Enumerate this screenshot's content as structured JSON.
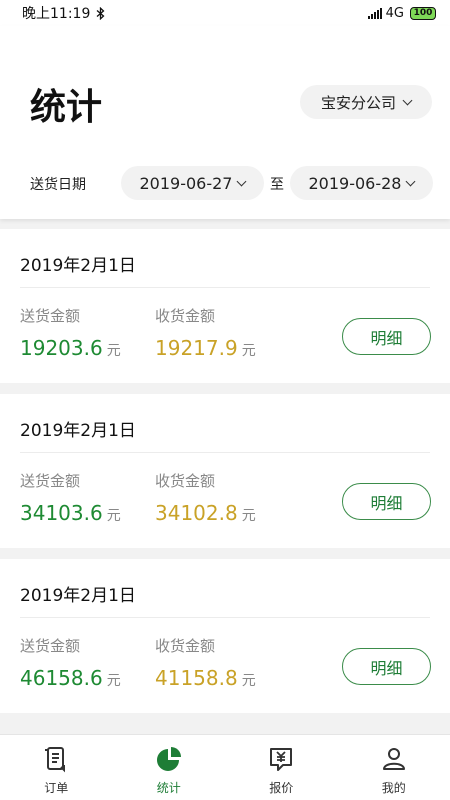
{
  "status_bar": {
    "time": "晚上11:19",
    "network": "4G",
    "battery": "100"
  },
  "header": {
    "title": "统计",
    "company": "宝安分公司"
  },
  "filter": {
    "date_label": "送货日期",
    "date_from": "2019-06-27",
    "separator": "至",
    "date_to": "2019-06-28"
  },
  "cards": [
    {
      "date": "2019年2月1日",
      "send_label": "送货金额",
      "recv_label": "收货金额",
      "send_amount": "19203.6",
      "recv_amount": "19217.9",
      "unit": "元",
      "detail_label": "明细"
    },
    {
      "date": "2019年2月1日",
      "send_label": "送货金额",
      "recv_label": "收货金额",
      "send_amount": "34103.6",
      "recv_amount": "34102.8",
      "unit": "元",
      "detail_label": "明细"
    },
    {
      "date": "2019年2月1日",
      "send_label": "送货金额",
      "recv_label": "收货金额",
      "send_amount": "46158.6",
      "recv_amount": "41158.8",
      "unit": "元",
      "detail_label": "明细"
    }
  ],
  "tabs": [
    {
      "label": "订单",
      "icon": "document-icon"
    },
    {
      "label": "统计",
      "icon": "pie-chart-icon"
    },
    {
      "label": "报价",
      "icon": "yen-price-icon"
    },
    {
      "label": "我的",
      "icon": "user-icon"
    }
  ],
  "colors": {
    "accent": "#1e7d36",
    "send": "#1e8a33",
    "receive": "#c9a227"
  }
}
